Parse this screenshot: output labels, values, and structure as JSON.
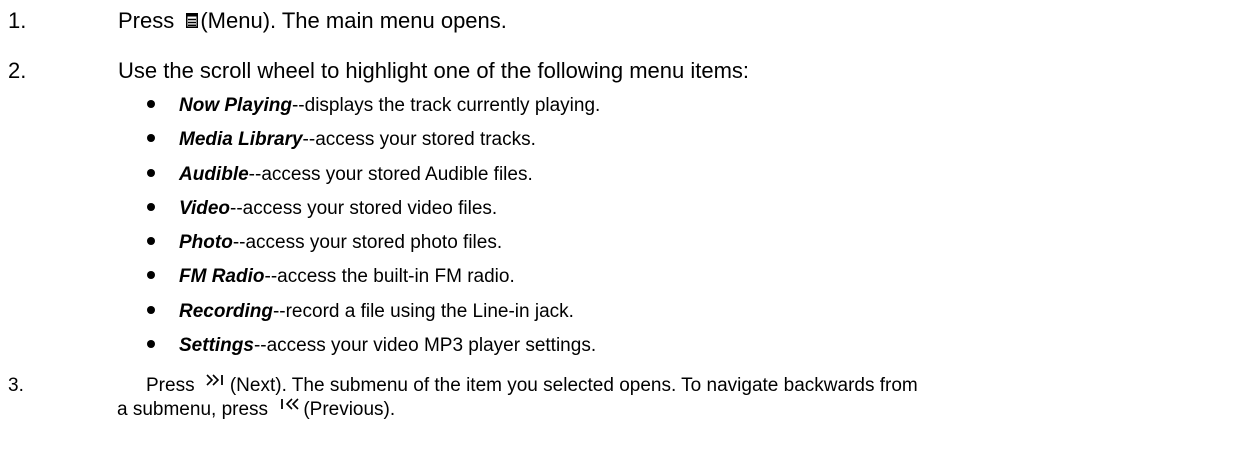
{
  "steps": [
    {
      "number": "1.",
      "before_icon": "Press ",
      "icon": "menu-icon",
      "after_icon": "(Menu). The main menu opens."
    },
    {
      "number": "2.",
      "text": "Use the scroll wheel to highlight one of the following menu items:",
      "items": [
        {
          "term": "Now Playing",
          "desc": "--displays the track currently playing."
        },
        {
          "term": "Media Library",
          "desc": "--access your stored tracks."
        },
        {
          "term": "Audible",
          "desc": "--access your stored Audible files."
        },
        {
          "term": "Video",
          "desc": "--access your stored video files."
        },
        {
          "term": "Photo",
          "desc": "--access your stored photo files."
        },
        {
          "term": "FM Radio",
          "desc": "--access the built-in FM radio."
        },
        {
          "term": "Recording",
          "desc": "--record a file using the Line-in jack."
        },
        {
          "term": "Settings",
          "desc": "--access your video MP3 player settings."
        }
      ]
    },
    {
      "number": "3.",
      "before_icon": "Press ",
      "icon": "next-icon",
      "after_icon": "(Next). The submenu of the item you selected opens. To navigate backwards from",
      "line2_before": "a submenu, press ",
      "line2_icon": "previous-icon",
      "line2_after": "(Previous)."
    }
  ]
}
